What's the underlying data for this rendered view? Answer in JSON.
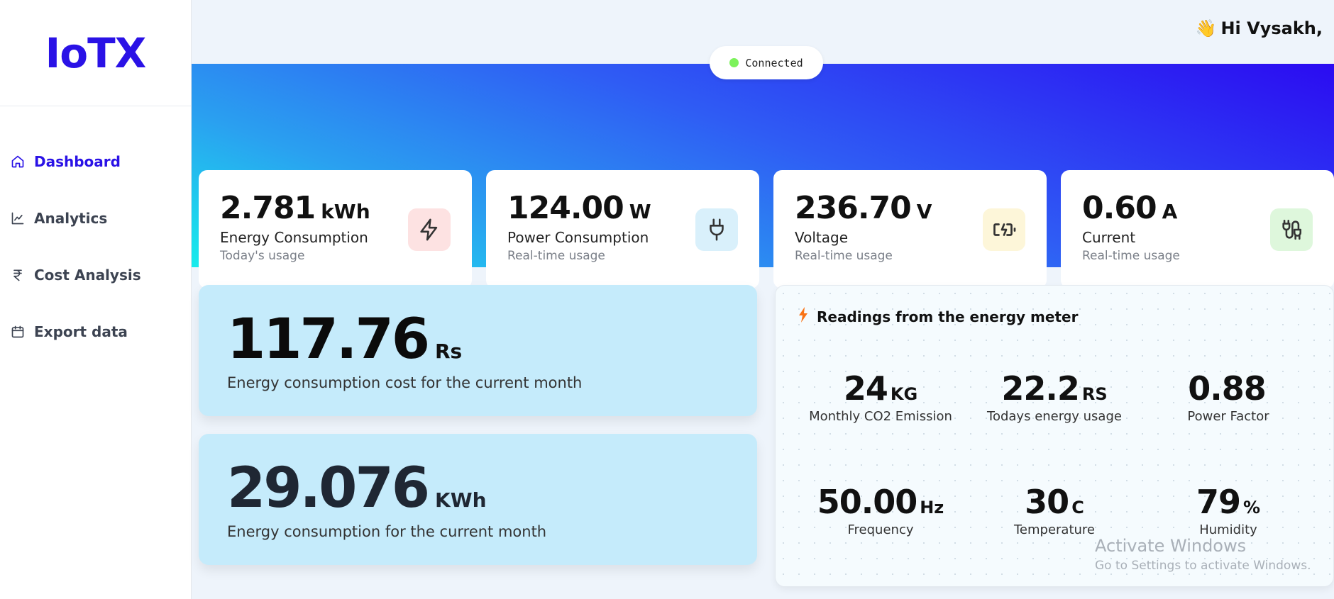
{
  "app": {
    "logo": "IoTX"
  },
  "sidebar": {
    "items": [
      {
        "label": "Dashboard",
        "icon": "home-icon",
        "active": true
      },
      {
        "label": "Analytics",
        "icon": "chart-line-icon"
      },
      {
        "label": "Cost Analysis",
        "icon": "rupee-icon"
      },
      {
        "label": "Export data",
        "icon": "calendar-icon"
      }
    ]
  },
  "header": {
    "greeting": "Hi Vysakh,",
    "wave_emoji": "👋"
  },
  "status": {
    "label": "Connected",
    "color": "#7cf25b"
  },
  "stats": [
    {
      "value": "2.781",
      "unit": "kWh",
      "title": "Energy Consumption",
      "subtitle": "Today's usage",
      "icon": "bolt-icon",
      "icon_bg": "#fde2e2"
    },
    {
      "value": "124.00",
      "unit": "W",
      "title": "Power Consumption",
      "subtitle": "Real-time usage",
      "icon": "plug-icon",
      "icon_bg": "#d9f0fb"
    },
    {
      "value": "236.70",
      "unit": "V",
      "title": "Voltage",
      "subtitle": "Real-time usage",
      "icon": "battery-charging-icon",
      "icon_bg": "#fdf6d9"
    },
    {
      "value": "0.60",
      "unit": "A",
      "title": "Current",
      "subtitle": "Real-time usage",
      "icon": "cable-icon",
      "icon_bg": "#def7dc"
    }
  ],
  "cost_cards": [
    {
      "value": "117.76",
      "unit": "Rs",
      "label": "Energy consumption cost for the current month"
    },
    {
      "value": "29.076",
      "unit": "KWh",
      "label": "Energy consumption for the current month"
    }
  ],
  "readings": {
    "title": "Readings from the energy meter",
    "metrics": [
      {
        "value": "24",
        "unit": "KG",
        "label": "Monthly CO2 Emission"
      },
      {
        "value": "22.2",
        "unit": "RS",
        "label": "Todays energy usage"
      },
      {
        "value": "0.88",
        "unit": "",
        "label": "Power Factor"
      },
      {
        "value": "50.00",
        "unit": "Hz",
        "label": "Frequency"
      },
      {
        "value": "30",
        "unit": "C",
        "label": "Temperature"
      },
      {
        "value": "79",
        "unit": "%",
        "label": "Humidity"
      }
    ]
  },
  "watermark": {
    "title": "Activate Windows",
    "subtitle": "Go to Settings to activate Windows."
  },
  "colors": {
    "brand": "#2a12e6",
    "accent_orange": "#f97316"
  }
}
